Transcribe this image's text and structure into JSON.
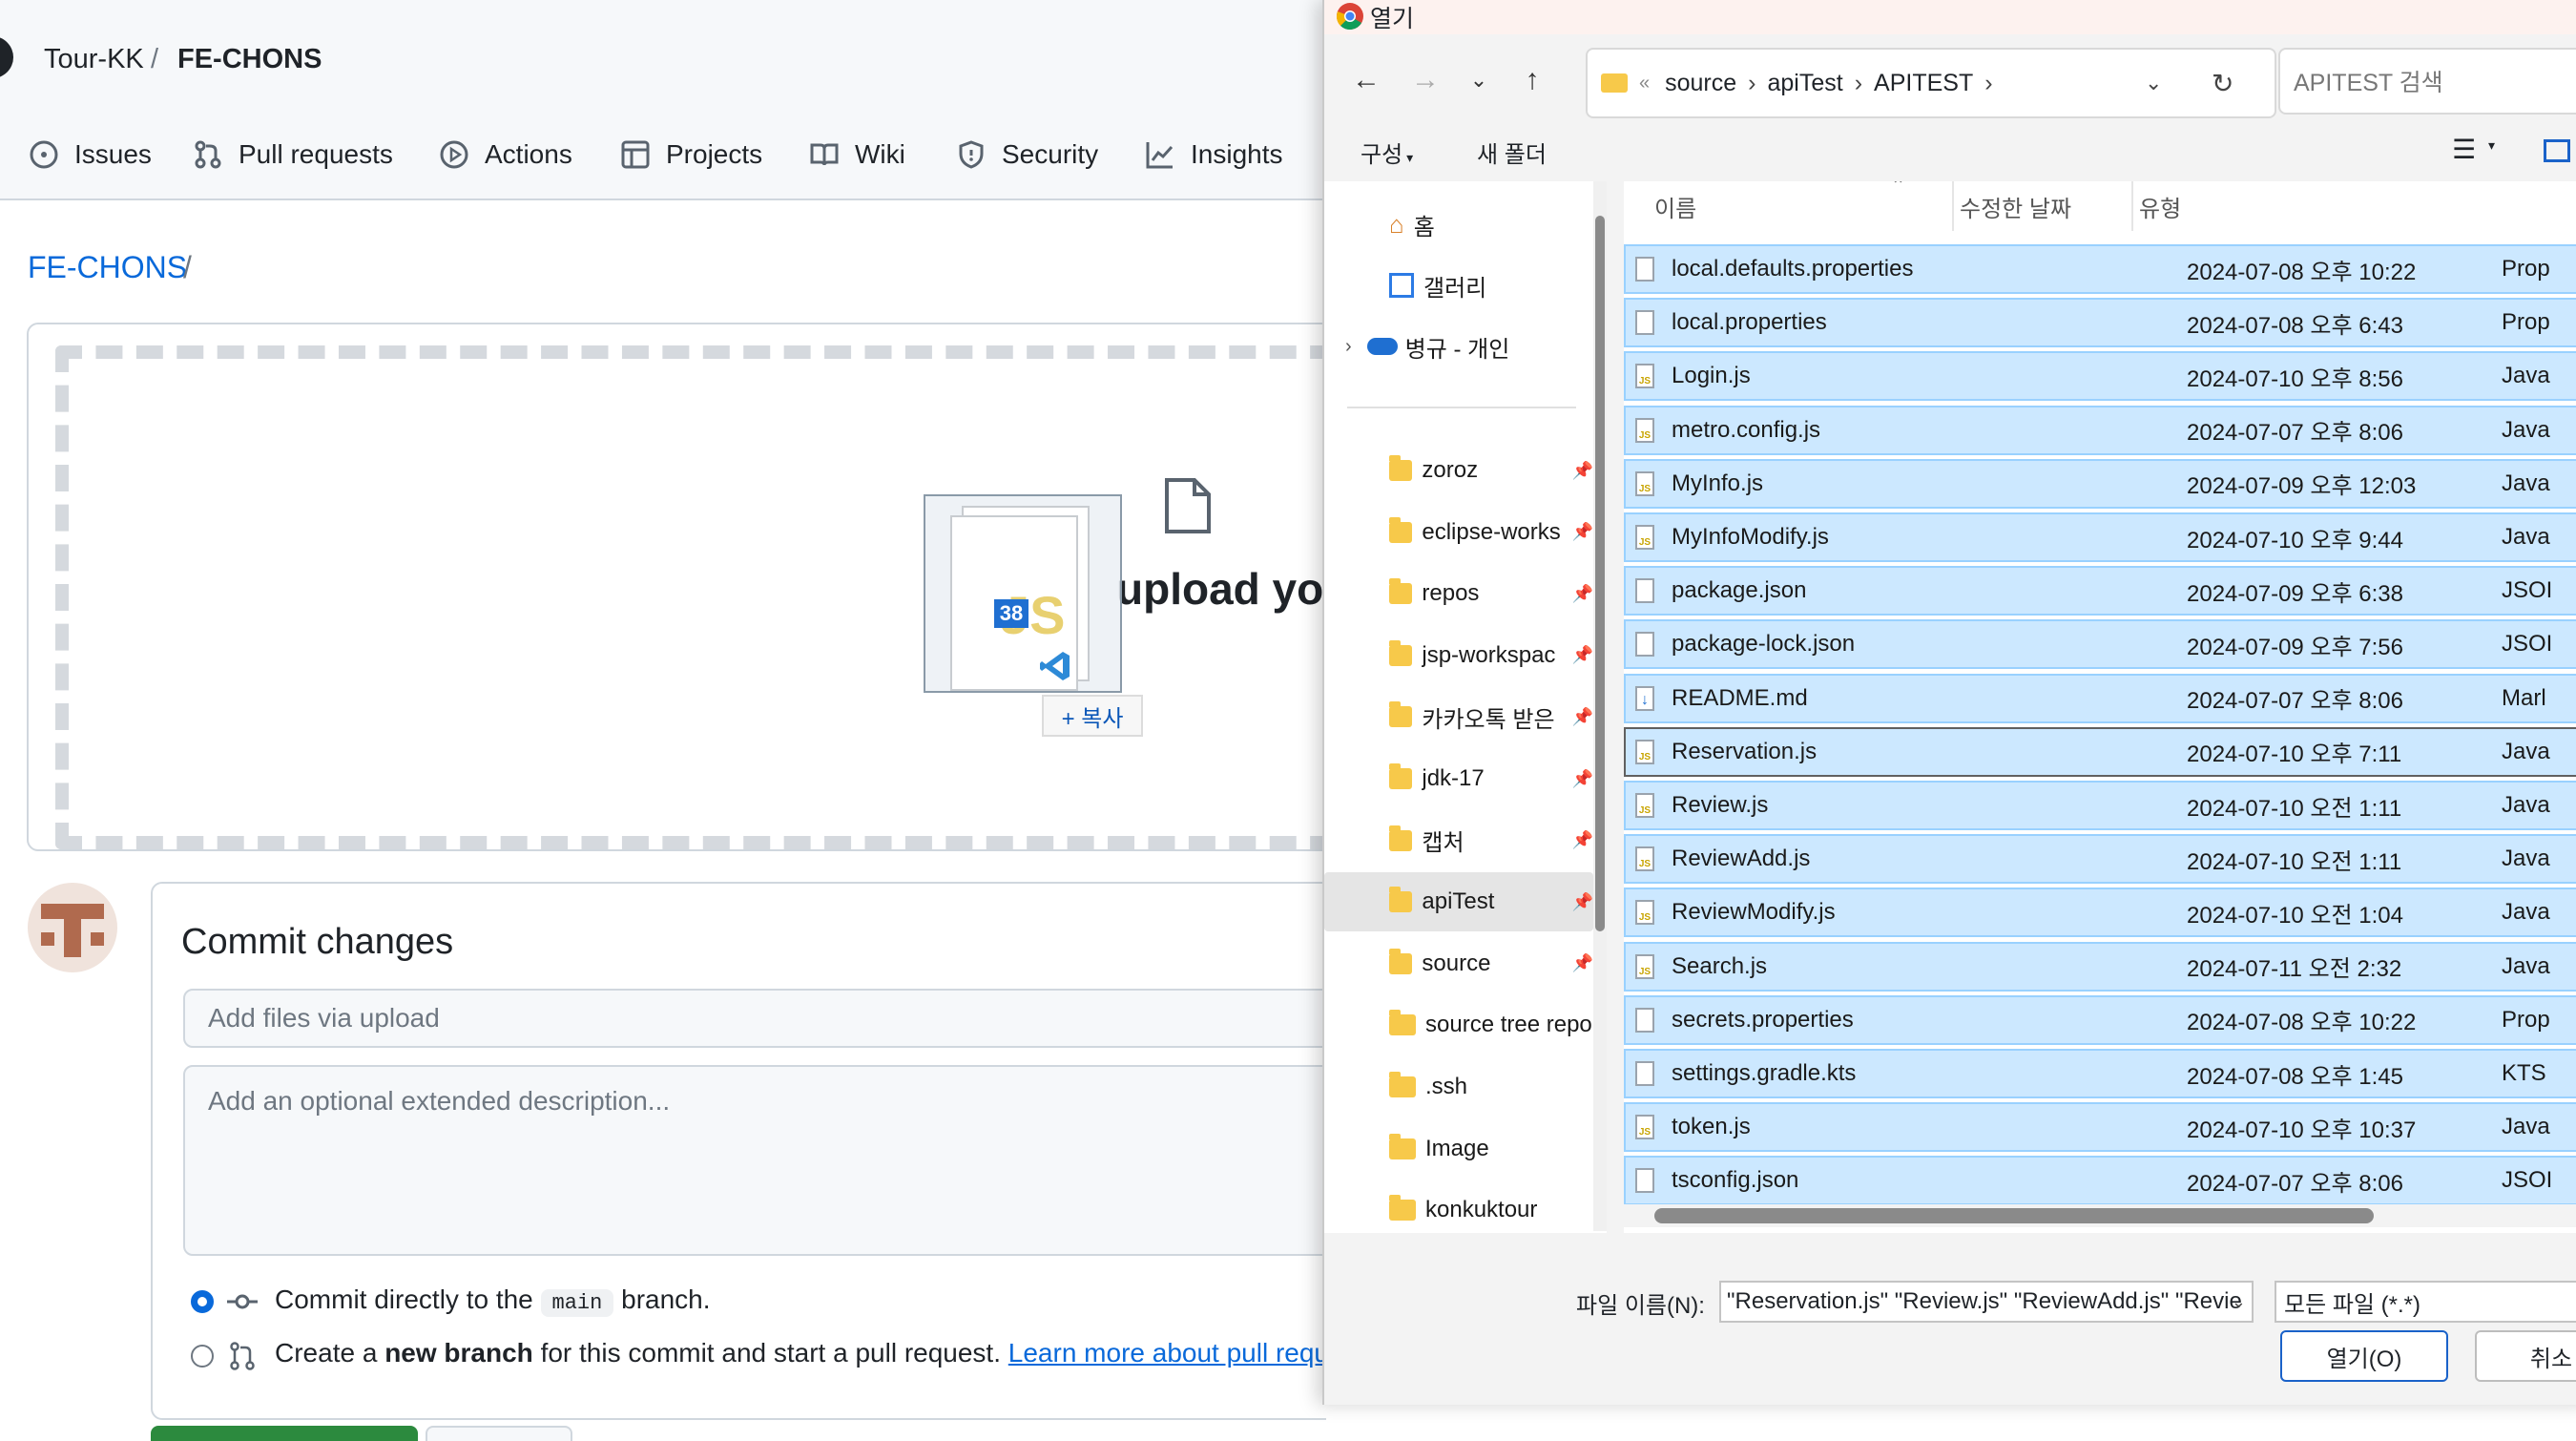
{
  "github": {
    "breadcrumb_owner": "Tour-KK",
    "breadcrumb_sep": "/",
    "breadcrumb_repo": "FE-CHONS",
    "nav": [
      {
        "label": "Issues",
        "icon": "issue-icon"
      },
      {
        "label": "Pull requests",
        "icon": "pull-request-icon"
      },
      {
        "label": "Actions",
        "icon": "actions-play-icon"
      },
      {
        "label": "Projects",
        "icon": "projects-table-icon"
      },
      {
        "label": "Wiki",
        "icon": "wiki-book-icon"
      },
      {
        "label": "Security",
        "icon": "shield-icon"
      },
      {
        "label": "Insights",
        "icon": "graph-icon"
      }
    ],
    "repo_path": "FE-CHONS",
    "repo_path_sep": "/",
    "drop_text": "upload you",
    "drag_badge_count": "38",
    "copy_label": "+ 복사",
    "commit_title": "Commit changes",
    "commit_message_placeholder": "Add files via upload",
    "commit_description_placeholder": "Add an optional extended description...",
    "option_direct_prefix": "Commit directly to the",
    "option_direct_branch": "main",
    "option_direct_suffix": "branch.",
    "option_new_prefix": "Create a",
    "option_new_bold": "new branch",
    "option_new_suffix": "for this commit and start a pull request.",
    "option_new_link": "Learn more about pull requ"
  },
  "dialog": {
    "title": "열기",
    "address": {
      "overflow": "«",
      "parts": [
        "source",
        "apiTest",
        "APITEST"
      ]
    },
    "search_placeholder": "APITEST 검색",
    "toolbar": {
      "organize": "구성",
      "new_folder": "새 폴더"
    },
    "sidebar_top": [
      {
        "label": "홈",
        "icon": "home-icon"
      },
      {
        "label": "갤러리",
        "icon": "gallery-icon"
      },
      {
        "label": "병규 - 개인",
        "icon": "onedrive-cloud-icon"
      }
    ],
    "sidebar_folders": [
      {
        "label": "zoroz",
        "pinned": true
      },
      {
        "label": "eclipse-works",
        "pinned": true
      },
      {
        "label": "repos",
        "pinned": true
      },
      {
        "label": "jsp-workspac",
        "pinned": true
      },
      {
        "label": "카카오톡 받은",
        "pinned": true
      },
      {
        "label": "jdk-17",
        "pinned": true
      },
      {
        "label": "캡처",
        "pinned": true
      },
      {
        "label": "apiTest",
        "pinned": true,
        "selected": true
      },
      {
        "label": "source",
        "pinned": true
      },
      {
        "label": "source tree repo",
        "pinned": false
      },
      {
        "label": ".ssh",
        "pinned": false
      },
      {
        "label": "Image",
        "pinned": false
      },
      {
        "label": "konkuktour",
        "pinned": false
      }
    ],
    "columns": {
      "name": "이름",
      "modified": "수정한 날짜",
      "type": "유형"
    },
    "files": [
      {
        "name": "local.defaults.properties",
        "modified": "2024-07-08 오후 10:22",
        "type": "Prop",
        "kind": "doc"
      },
      {
        "name": "local.properties",
        "modified": "2024-07-08 오후 6:43",
        "type": "Prop",
        "kind": "doc"
      },
      {
        "name": "Login.js",
        "modified": "2024-07-10 오후 8:56",
        "type": "Java",
        "kind": "js"
      },
      {
        "name": "metro.config.js",
        "modified": "2024-07-07 오후 8:06",
        "type": "Java",
        "kind": "js"
      },
      {
        "name": "MyInfo.js",
        "modified": "2024-07-09 오후 12:03",
        "type": "Java",
        "kind": "js"
      },
      {
        "name": "MyInfoModify.js",
        "modified": "2024-07-10 오후 9:44",
        "type": "Java",
        "kind": "js"
      },
      {
        "name": "package.json",
        "modified": "2024-07-09 오후 6:38",
        "type": "JSOI",
        "kind": "blank"
      },
      {
        "name": "package-lock.json",
        "modified": "2024-07-09 오후 7:56",
        "type": "JSOI",
        "kind": "blank"
      },
      {
        "name": "README.md",
        "modified": "2024-07-07 오후 8:06",
        "type": "Marl",
        "kind": "md"
      },
      {
        "name": "Reservation.js",
        "modified": "2024-07-10 오후 7:11",
        "type": "Java",
        "kind": "js"
      },
      {
        "name": "Review.js",
        "modified": "2024-07-10 오전 1:11",
        "type": "Java",
        "kind": "js"
      },
      {
        "name": "ReviewAdd.js",
        "modified": "2024-07-10 오전 1:11",
        "type": "Java",
        "kind": "js"
      },
      {
        "name": "ReviewModify.js",
        "modified": "2024-07-10 오전 1:04",
        "type": "Java",
        "kind": "js"
      },
      {
        "name": "Search.js",
        "modified": "2024-07-11 오전 2:32",
        "type": "Java",
        "kind": "js"
      },
      {
        "name": "secrets.properties",
        "modified": "2024-07-08 오후 10:22",
        "type": "Prop",
        "kind": "doc"
      },
      {
        "name": "settings.gradle.kts",
        "modified": "2024-07-08 오후 1:45",
        "type": "KTS",
        "kind": "blank"
      },
      {
        "name": "token.js",
        "modified": "2024-07-10 오후 10:37",
        "type": "Java",
        "kind": "js"
      },
      {
        "name": "tsconfig.json",
        "modified": "2024-07-07 오후 8:06",
        "type": "JSOI",
        "kind": "blank"
      }
    ],
    "filename_label": "파일 이름(N):",
    "filename_value": "\"Reservation.js\" \"Review.js\" \"ReviewAdd.js\" \"Revie",
    "filter_value": "모든 파일 (*.*)",
    "open_button": "열기(O)",
    "cancel_button": "취소"
  }
}
